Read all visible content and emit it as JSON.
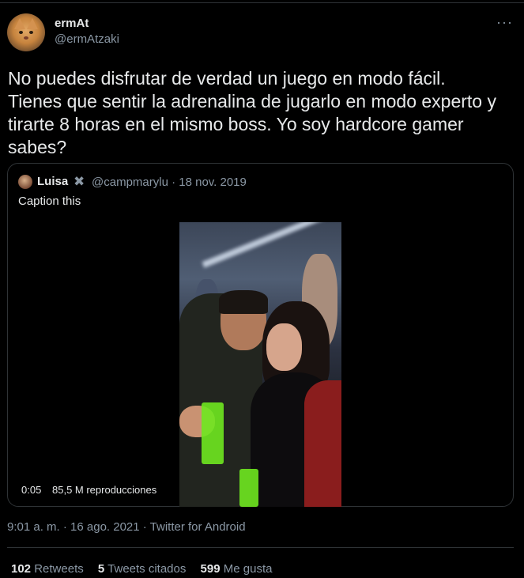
{
  "author": {
    "name": "ermAt",
    "handle": "@ermAtzaki"
  },
  "more_icon": "more-horizontal-icon",
  "tweet": {
    "text_lines": [
      "No puedes disfrutar de verdad un juego en modo fácil.",
      "Tienes que sentir la adrenalina de jugarlo en modo experto y",
      "tirarte 8 horas en el mismo boss. Yo soy hardcore gamer",
      "sabes?"
    ]
  },
  "quote": {
    "name": "Luisa",
    "badge": "✖",
    "handle": "@campmarylu · 18 nov. 2019",
    "text": "Caption this",
    "video": {
      "time": "0:05",
      "views": "85,5 M reproducciones"
    }
  },
  "meta": "9:01 a. m. · 16 ago. 2021 · Twitter for Android",
  "stats": [
    {
      "count": "102",
      "label": "Retweets"
    },
    {
      "count": "5",
      "label": "Tweets citados"
    },
    {
      "count": "599",
      "label": "Me gusta"
    }
  ]
}
